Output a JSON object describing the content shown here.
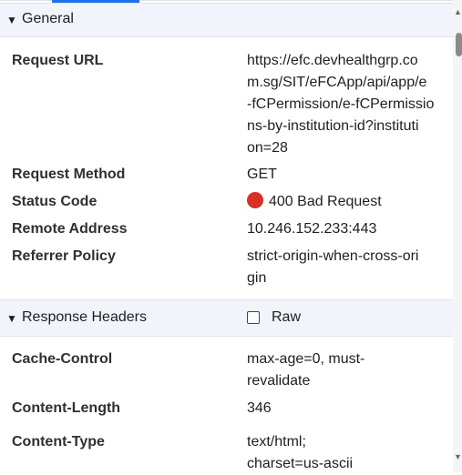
{
  "general": {
    "title": "General",
    "rows": [
      {
        "key": "Request URL",
        "value": "https://efc.devhealthgrp.co\nm.sg/SIT/eFCApp/api/app/e\n-fCPermission/e-fCPermissio\nns-by-institution-id?instituti\non=28"
      },
      {
        "key": "Request Method",
        "value": "GET"
      },
      {
        "key": "Status Code",
        "value": "400 Bad Request"
      },
      {
        "key": "Remote Address",
        "value": "10.246.152.233:443"
      },
      {
        "key": "Referrer Policy",
        "value": "strict-origin-when-cross-ori\ngin"
      }
    ]
  },
  "response_headers": {
    "title": "Response Headers",
    "raw_label": "Raw",
    "raw_checked": false,
    "rows": [
      {
        "key": "Cache-Control",
        "value": "max-age=0, must-\nrevalidate"
      },
      {
        "key": "Content-Length",
        "value": "346"
      },
      {
        "key": "Content-Type",
        "value": "text/html;\ncharset=us-ascii"
      }
    ]
  },
  "colors": {
    "status_error": "#d93025",
    "section_bg": "#f1f4fa",
    "accent": "#1a73e8"
  },
  "icons": {
    "caret": "caret-down-icon",
    "status": "status-error-dot-icon",
    "checkbox": "checkbox-icon"
  }
}
